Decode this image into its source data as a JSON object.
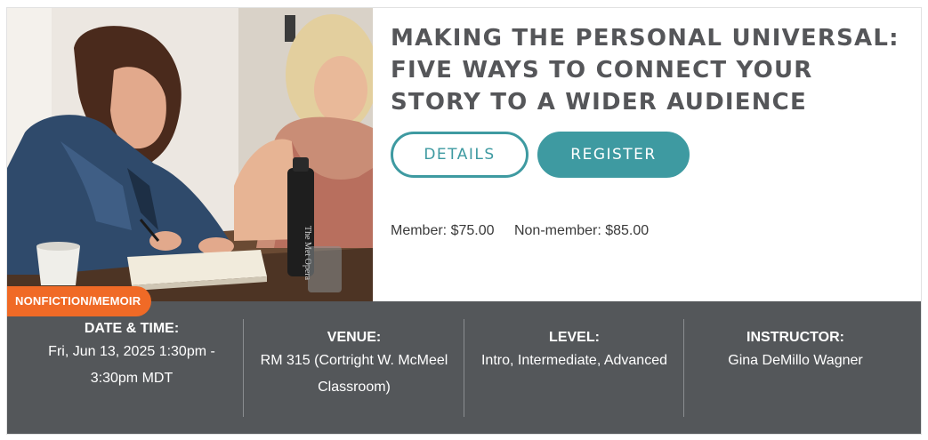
{
  "event": {
    "category": "NONFICTION/MEMOIR",
    "title_lines": [
      "MAKING THE PERSONAL UNIVERSAL:",
      "FIVE WAYS TO CONNECT YOUR",
      "STORY TO A WIDER AUDIENCE"
    ],
    "details_label": "DETAILS",
    "register_label": "REGISTER",
    "member_price": "Member: $75.00",
    "nonmember_price": "Non-member: $85.00",
    "photo_alt": "Two women writing at a classroom table",
    "bottle_text": "The Met Opera"
  },
  "info": {
    "date": {
      "label": "DATE & TIME:",
      "lines": [
        "Fri, Jun 13, 2025 1:30pm -",
        "3:30pm MDT"
      ]
    },
    "venue": {
      "label": "VENUE:",
      "lines": [
        "RM 315 (Cortright W. McMeel",
        "Classroom)"
      ]
    },
    "level": {
      "label": "LEVEL:",
      "lines": [
        "Intro, Intermediate, Advanced"
      ]
    },
    "instructor": {
      "label": "INSTRUCTOR:",
      "lines": [
        "Gina DeMillo Wagner"
      ]
    }
  },
  "colors": {
    "accent": "#3e9aa1",
    "badge": "#f06a26",
    "info_bar": "#54575a",
    "title": "#555659"
  }
}
